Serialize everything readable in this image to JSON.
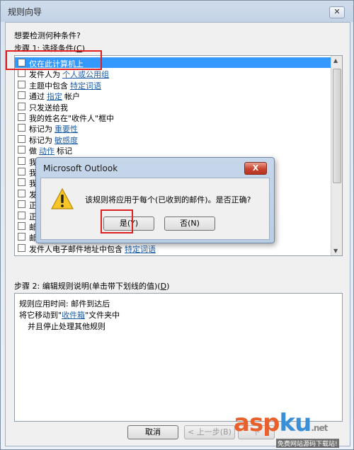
{
  "window": {
    "title": "规则向导",
    "close_glyph": "✕"
  },
  "question": "想要检测何种条件?",
  "step1": {
    "label": "步骤 1: 选择条件(",
    "key": "C",
    "suffix": ")"
  },
  "conditions": [
    {
      "text": "仅在此计算机上",
      "link": "",
      "selected": true
    },
    {
      "text": "发件人为",
      "link": "个人或公用组",
      "selected": false
    },
    {
      "text": "主题中包含",
      "link": "特定词语",
      "selected": false
    },
    {
      "text": "通过",
      "link": "指定",
      "after": "帐户",
      "selected": false
    },
    {
      "text": "只发送给我",
      "link": "",
      "selected": false
    },
    {
      "text": "我的姓名在\"收件人\"框中",
      "link": "",
      "selected": false
    },
    {
      "text": "标记为",
      "link": "重要性",
      "selected": false
    },
    {
      "text": "标记为",
      "link": "敏感度",
      "selected": false
    },
    {
      "text": "做",
      "link": "动作",
      "after": "标记",
      "selected": false
    },
    {
      "text": "我",
      "link": "",
      "selected": false
    },
    {
      "text": "我",
      "link": "",
      "selected": false
    },
    {
      "text": "我",
      "link": "",
      "selected": false
    },
    {
      "text": "发",
      "link": "",
      "selected": false
    },
    {
      "text": "正",
      "link": "",
      "selected": false
    },
    {
      "text": "正",
      "link": "",
      "selected": false
    },
    {
      "text": "邮",
      "link": "",
      "selected": false
    },
    {
      "text": "邮",
      "link": "",
      "selected": false
    },
    {
      "text": "发件人电子邮件地址中包含",
      "link": "特定词语",
      "selected": false
    }
  ],
  "step2": {
    "label": "步骤 2: 编辑规则说明(单击带下划线的值)(",
    "key": "D",
    "suffix": ")"
  },
  "description": {
    "line1": "规则应用时间: 邮件到达后",
    "line2_pre": "将它移动到\"",
    "line2_link": "收件箱",
    "line2_post": "\"文件夹中",
    "line3": "并且停止处理其他规则"
  },
  "buttons": {
    "cancel": "取消",
    "back": "< 上一步(B)",
    "next": "下"
  },
  "dialog": {
    "title": "Microsoft Outlook",
    "close_glyph": "X",
    "message": "该规则将应用于每个(已收到的邮件)。是否正确?",
    "yes": "是(Y)",
    "no": "否(N)",
    "icon": "warning-icon"
  },
  "watermark": {
    "logo_a": "asp",
    "logo_b": "ku",
    "logo_c": ".net",
    "sub": "免费网站源码下载站!"
  },
  "colors": {
    "selection": "#3399ff",
    "link": "#1f5fa8",
    "highlight_box": "#e02020"
  }
}
